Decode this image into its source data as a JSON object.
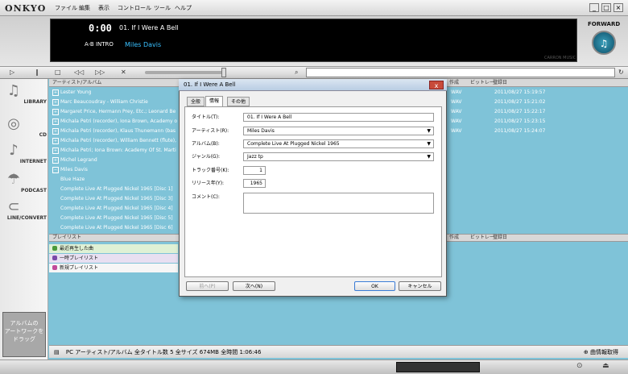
{
  "app": {
    "logo": "ONKYO",
    "forward_label": "FORWARD"
  },
  "menu": [
    "ファイル",
    "編集",
    "表示",
    "コントロール",
    "ツール",
    "ヘルプ"
  ],
  "player": {
    "time": "0:00",
    "track": "01. If I Were A Bell",
    "ab": "A-B INTRO",
    "artist": "Miles Davis",
    "brand": "CARRON MUSIC"
  },
  "nav": [
    {
      "label": "LIBRARY",
      "icon": "library-icon",
      "glyph": "♫"
    },
    {
      "label": "CD",
      "icon": "cd-icon",
      "glyph": "◎"
    },
    {
      "label": "INTERNET",
      "icon": "internet-icon",
      "glyph": "♪"
    },
    {
      "label": "PODCAST",
      "icon": "podcast-icon",
      "glyph": "☂"
    },
    {
      "label": "LINE/CONVERT",
      "icon": "line-icon",
      "glyph": "⊂"
    }
  ],
  "drag_box": {
    "line1": "アルバムの",
    "line2": "アートワークを",
    "line3": "ドラッグ"
  },
  "library": {
    "header": "アーティスト/アルバム",
    "col_artist_jp": "作成",
    "col_bitrate": "ビットレー..",
    "col_date": "登録日",
    "rows": [
      {
        "text": "Lester Young",
        "box": "+"
      },
      {
        "text": "Marc Beaucoudray - William Christie",
        "box": "+"
      },
      {
        "text": "Margaret Price, Hermann Prey, Etc.; Leonard Be",
        "box": "+"
      },
      {
        "text": "Michala Petri (recorder), Iona Brown, Academy o",
        "box": "+"
      },
      {
        "text": "Michala Petri (recorder), Klaus Thunemann (bas",
        "box": "+"
      },
      {
        "text": "Michala Petri (recorder), William Bennett (flute),",
        "box": "+"
      },
      {
        "text": "Michala Petri; Iona Brown: Academy Of St. Marti",
        "box": "+"
      },
      {
        "text": "Michel Legrand",
        "box": "+"
      },
      {
        "text": "Miles Davis",
        "box": "−"
      },
      {
        "text": "Blue Haze",
        "box": ""
      },
      {
        "text": "Complete Live At Plugged Nickel 1965 [Disc 1]",
        "box": ""
      },
      {
        "text": "Complete Live At Plugged Nickel 1965 [Disc 3]",
        "box": ""
      },
      {
        "text": "Complete Live At Plugged Nickel 1965 [Disc 4]",
        "box": ""
      },
      {
        "text": "Complete Live At Plugged Nickel 1965 [Disc 5]",
        "box": ""
      },
      {
        "text": "Complete Live At Plugged Nickel 1965 [Disc 6]",
        "box": ""
      }
    ],
    "right_rows": [
      {
        "fmt": "WAV",
        "date": "2011/08/27 15:19:57"
      },
      {
        "fmt": "WAV",
        "date": "2011/08/27 15:21:02"
      },
      {
        "fmt": "WAV",
        "date": "2011/08/27 15:22:17"
      },
      {
        "fmt": "WAV",
        "date": "2011/08/27 15:23:15"
      },
      {
        "fmt": "WAV",
        "date": "2011/08/27 15:24:07"
      }
    ]
  },
  "playlist": {
    "header": "プレイリスト",
    "items": [
      "最近再生した曲",
      "一時プレイリスト",
      "新規プレイリスト"
    ]
  },
  "status": {
    "text": "PC アーティスト/アルバム   全タイトル数 5   全サイズ 674MB   全時間 1:06:46",
    "info_button": "曲情報取得"
  },
  "dialog": {
    "title": "01. If I Were A Bell",
    "close": "x",
    "tabs": [
      "全般",
      "情報",
      "その他"
    ],
    "fields": {
      "title_label": "タイトル(T):",
      "title_value": "01. If I Were A Bell",
      "artist_label": "アーティスト(R):",
      "artist_value": "Miles Davis",
      "album_label": "アルバム(B):",
      "album_value": "Complete Live At Plugged Nickel 1965",
      "genre_label": "ジャンル(G):",
      "genre_value": "Jazz tp",
      "track_label": "トラック番号(K):",
      "track_value": "1",
      "year_label": "リリース年(Y):",
      "year_value": "1965",
      "comment_label": "コメント(C):",
      "comment_value": ""
    },
    "buttons": {
      "prev": "前へ(P)",
      "next": "次へ(N)",
      "ok": "OK",
      "cancel": "キャンセル"
    }
  }
}
